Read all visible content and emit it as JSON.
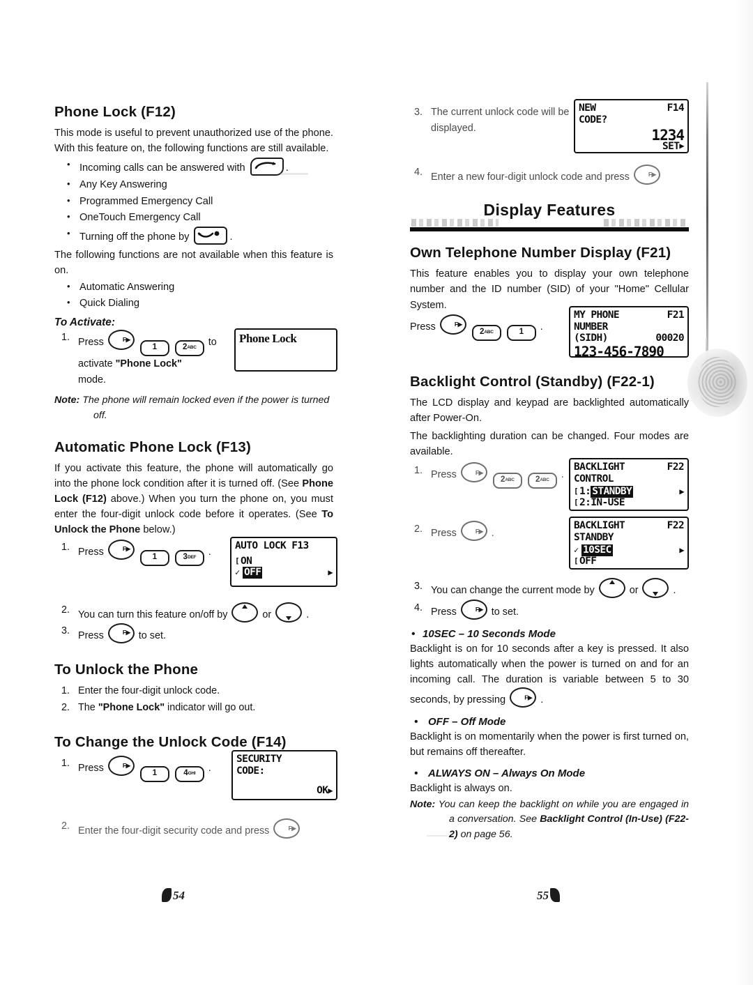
{
  "document": {
    "type": "cellular-phone-user-manual-spread",
    "left_page_number": "54",
    "right_page_number": "55"
  },
  "left_column": {
    "phone_lock": {
      "heading": "Phone Lock (F12)",
      "intro": "This mode is useful to prevent unauthorized use of the phone. With this feature on, the following functions are still available.",
      "available_items": [
        "Incoming calls can be answered with",
        "Any Key Answering",
        "Programmed Emergency Call",
        "OneTouch Emergency Call",
        "Turning off the phone by"
      ],
      "unavailable_intro": "The following functions are not available when this feature is on.",
      "unavailable_items": [
        "Automatic Answering",
        "Quick Dialing"
      ],
      "to_activate_label": "To Activate:",
      "step1_num": "1.",
      "step1_press": "Press",
      "step1_to": "to",
      "step1_rest": "activate \"Phone Lock\" mode.",
      "step1_rest_plain_a": "activate",
      "step1_rest_bold": "\"Phone Lock\"",
      "step1_rest_plain_b": "mode.",
      "keys": {
        "fcn": "FCN",
        "one": "1",
        "two": "2",
        "two_sub": "ABC"
      },
      "note_label": "Note:",
      "note_text": "The phone will remain locked even if the power is turned off.",
      "lcd": {
        "line1": "Phone Lock"
      }
    },
    "automatic_phone_lock": {
      "heading": "Automatic Phone Lock (F13)",
      "intro_a": "If you activate this feature, the phone will automatically go into the phone lock condition after it is turned off. (See",
      "intro_bold_1": "Phone Lock (F12)",
      "intro_b": "above.) When you turn the phone on, you must enter the four-digit unlock code before it operates. (See",
      "intro_bold_2": "To Unlock the Phone",
      "intro_c": "below.)",
      "step1_num": "1.",
      "step1_press": "Press",
      "step1_trail": ".",
      "step2_num": "2.",
      "step2_text_a": "You can turn this feature on/off by",
      "step2_or": "or",
      "step2_trail": ".",
      "step3_num": "3.",
      "step3_text_a": "Press",
      "step3_text_b": "to set.",
      "keys": {
        "fcn": "FCN",
        "one": "1",
        "three": "3",
        "three_sub": "DEF"
      },
      "lcd": {
        "title": "AUTO LOCK F13",
        "option_on": "ON",
        "option_off": "OFF",
        "selected": "OFF",
        "arrow": "▶"
      }
    },
    "to_unlock_the_phone": {
      "heading": "To Unlock the Phone",
      "steps": [
        {
          "num": "1.",
          "text": "Enter the four-digit unlock code."
        },
        {
          "num": "2.",
          "text_a": "The",
          "bold": "\"Phone Lock\"",
          "text_b": "indicator will go out."
        }
      ]
    },
    "to_change_unlock_code": {
      "heading": "To Change the Unlock Code (F14)",
      "step1_num": "1.",
      "step1_press": "Press",
      "step1_trail": ".",
      "step2_num": "2.",
      "step2_text": "Enter the four-digit security code and press",
      "keys": {
        "fcn": "FCN",
        "one": "1",
        "four": "4",
        "four_sub": "GHI"
      },
      "lcd": {
        "line1": "SECURITY",
        "line2": "CODE:",
        "ok": "OK",
        "arrow": "▶"
      }
    }
  },
  "right_column": {
    "unlock_code_continued": {
      "step3_num": "3.",
      "step3_text": "The current unlock code will be displayed.",
      "step4_num": "4.",
      "step4_text": "Enter a new four-digit unlock code and press",
      "lcd": {
        "line1_left": "NEW",
        "line1_right": "F14",
        "line2": "CODE?",
        "code": "1234",
        "set": "SET",
        "arrow": "▶"
      }
    },
    "banner": {
      "title": "Display Features"
    },
    "own_telephone_number": {
      "heading": "Own Telephone Number Display (F21)",
      "intro": "This feature enables you to display your own telephone number and the ID number (SID) of your \"Home\" Cellular System.",
      "press_label": "Press",
      "press_trail": ".",
      "keys": {
        "fcn": "FCN",
        "two": "2",
        "two_sub": "ABC",
        "one": "1"
      },
      "lcd": {
        "line1_left": "MY PHONE",
        "line1_right": "F21",
        "line2": "NUMBER",
        "line3_left": "(SIDH)",
        "line3_right": "00020",
        "line4": "123-456-7890"
      }
    },
    "backlight_control": {
      "heading": "Backlight Control (Standby) (F22-1)",
      "para1": "The LCD display and keypad are backlighted automatically after Power-On.",
      "para2": "The backlighting duration can be changed. Four modes are available.",
      "step1_num": "1.",
      "step1_press": "Press",
      "step1_trail": ".",
      "step2_num": "2.",
      "step2_press": "Press",
      "step2_trail": ".",
      "step3_num": "3.",
      "step3_text_a": "You can change the current mode by",
      "step3_or": "or",
      "step3_trail": ".",
      "step4_num": "4.",
      "step4_text_a": "Press",
      "step4_text_b": "to set.",
      "keys": {
        "fcn": "FCN",
        "two": "2",
        "two_sub": "ABC"
      },
      "lcd1": {
        "title_left": "BACKLIGHT",
        "title_right": "F22",
        "line2": "CONTROL",
        "option1": "1:STANDBY",
        "option1_prefix": "1:",
        "option1_value": "STANDBY",
        "option2": "2:IN-USE",
        "arrow": "▶"
      },
      "lcd2": {
        "title_left": "BACKLIGHT",
        "title_right": "F22",
        "line2": "STANDBY",
        "option1": "10SEC",
        "option2": "OFF",
        "check": "✓",
        "arrow": "▶"
      },
      "modes": [
        {
          "label": "10SEC – 10 Seconds Mode",
          "text_a": "Backlight is on for 10 seconds after a key is pressed. It also lights automatically when the power is turned on and for an incoming call. The duration is variable between 5 to 30 seconds, by pressing",
          "text_b": "."
        },
        {
          "label": "OFF – Off Mode",
          "text_a": "Backlight is on momentarily when the power is first turned on, but remains off thereafter.",
          "text_b": ""
        },
        {
          "label": "ALWAYS ON – Always On Mode",
          "text_a": "Backlight is always on.",
          "text_b": ""
        }
      ],
      "note_label": "Note:",
      "note_text_a": "You can keep the backlight on while you are engaged in a conversation. See",
      "note_bold": "Backlight Control (In-Use) (F22-2)",
      "note_text_b": "on page 56."
    }
  }
}
